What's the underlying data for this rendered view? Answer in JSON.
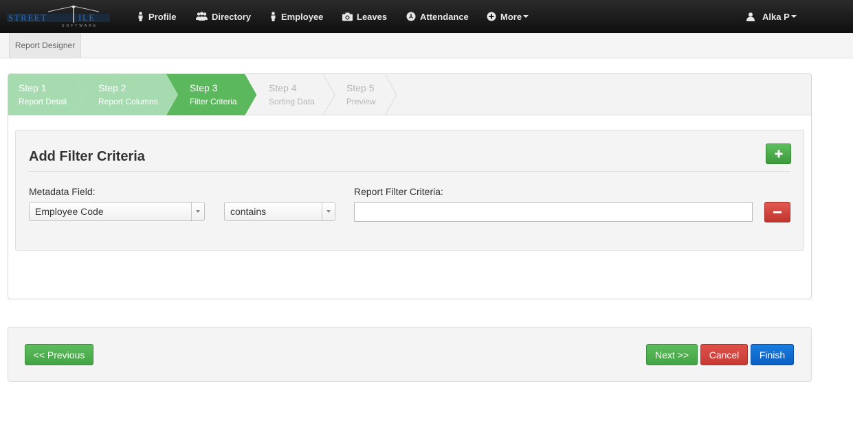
{
  "brand": {
    "logo_text": "STREET",
    "logo_sub": "SOFTWARE"
  },
  "nav": {
    "items": [
      {
        "label": "Profile",
        "icon": "person-icon"
      },
      {
        "label": "Directory",
        "icon": "group-icon"
      },
      {
        "label": "Employee",
        "icon": "person-icon"
      },
      {
        "label": "Leaves",
        "icon": "camera-icon"
      },
      {
        "label": "Attendance",
        "icon": "clock-icon"
      },
      {
        "label": "More",
        "icon": "plus-circle-icon"
      }
    ],
    "user": {
      "label": "Alka P",
      "icon": "user-icon"
    }
  },
  "subnav": {
    "tab": "Report Designer"
  },
  "wizard": {
    "steps": [
      {
        "title": "Step 1",
        "subtitle": "Report Detail",
        "state": "done"
      },
      {
        "title": "Step 2",
        "subtitle": "Report Columns",
        "state": "done"
      },
      {
        "title": "Step 3",
        "subtitle": "Filter Criteria",
        "state": "active"
      },
      {
        "title": "Step 4",
        "subtitle": "Sorting Data",
        "state": "pending"
      },
      {
        "title": "Step 5",
        "subtitle": "Preview",
        "state": "pending"
      }
    ],
    "colors": {
      "done": "#a6dbb0",
      "active": "#5cb85c",
      "pending": "#f3f3f3"
    }
  },
  "filter": {
    "title": "Add Filter Criteria",
    "metadata_label": "Metadata Field:",
    "metadata_value": "Employee Code",
    "operator_value": "contains",
    "criteria_label": "Report Filter Criteria:",
    "criteria_value": ""
  },
  "actions": {
    "previous": "<< Previous",
    "next": "Next >>",
    "cancel": "Cancel",
    "finish": "Finish"
  }
}
